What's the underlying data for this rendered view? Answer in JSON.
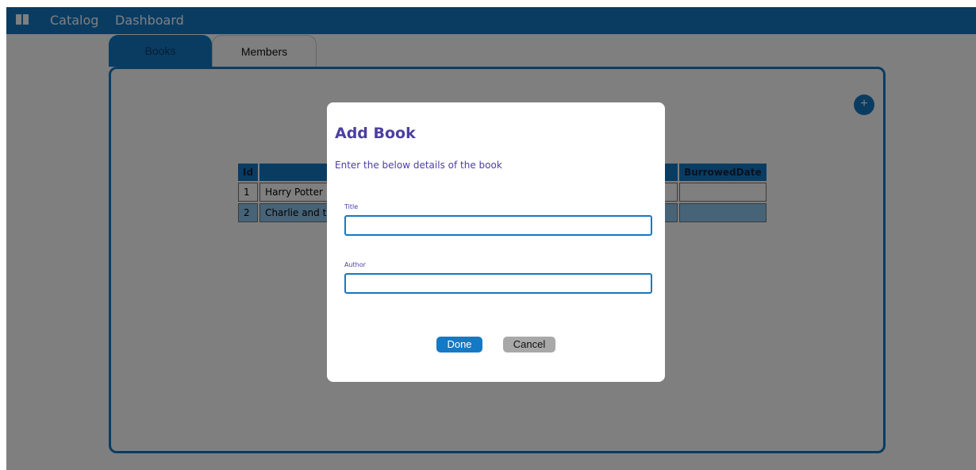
{
  "navbar": {
    "logo_icon": "book-icon",
    "items": [
      "Catalog",
      "Dashboard"
    ],
    "color": "#1579c4"
  },
  "tabs": [
    "Books",
    "Members"
  ],
  "panel": {
    "add_button_label": "+"
  },
  "table": {
    "headers": [
      "Id",
      "",
      "BurrowedDate"
    ],
    "rows": [
      {
        "id": "1",
        "title": "Harry Potter",
        "borrowed_date": ""
      },
      {
        "id": "2",
        "title": "Charlie and th",
        "borrowed_date": ""
      }
    ]
  },
  "modal": {
    "title": "Add Book",
    "subtitle": "Enter the below details of the book",
    "fields": [
      {
        "label": "Title",
        "value": ""
      },
      {
        "label": "Author",
        "value": ""
      }
    ],
    "done_label": "Done",
    "cancel_label": "Cancel"
  }
}
